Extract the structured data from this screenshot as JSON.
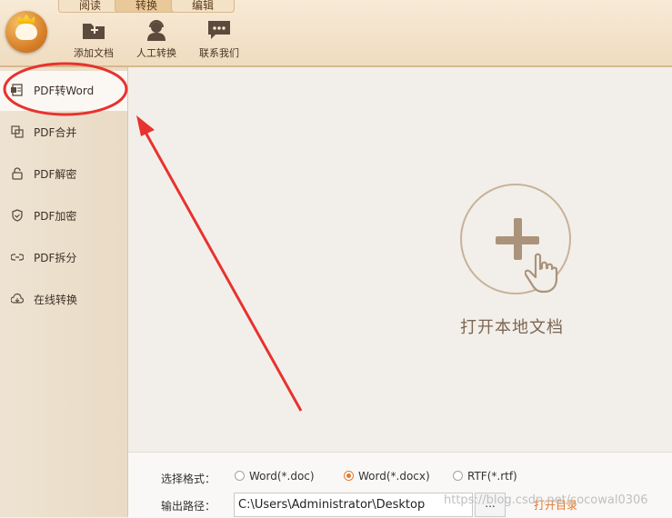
{
  "tabs": [
    "阅读",
    "转换",
    "编辑"
  ],
  "toolbar": {
    "add_doc": "添加文档",
    "manual_convert": "人工转换",
    "contact_us": "联系我们"
  },
  "sidebar": {
    "items": [
      {
        "label": "PDF转Word",
        "icon": "word-doc-icon"
      },
      {
        "label": "PDF合并",
        "icon": "merge-icon"
      },
      {
        "label": "PDF解密",
        "icon": "unlock-icon"
      },
      {
        "label": "PDF加密",
        "icon": "shield-icon"
      },
      {
        "label": "PDF拆分",
        "icon": "split-icon"
      },
      {
        "label": "在线转换",
        "icon": "cloud-icon"
      }
    ]
  },
  "main": {
    "open_local": "打开本地文档"
  },
  "bottom": {
    "format_label": "选择格式：",
    "formats": [
      {
        "label": "Word(*.doc)",
        "checked": false
      },
      {
        "label": "Word(*.docx)",
        "checked": true
      },
      {
        "label": "RTF(*.rtf)",
        "checked": false
      }
    ],
    "output_label": "输出路径：",
    "output_path": "C:\\Users\\Administrator\\Desktop",
    "browse": "...",
    "open_dir": "打开目录"
  },
  "watermark": "https://blog.csdn.net/cocowal0306",
  "colors": {
    "accent": "#e07a2f",
    "annotation_red": "#e8322f"
  }
}
